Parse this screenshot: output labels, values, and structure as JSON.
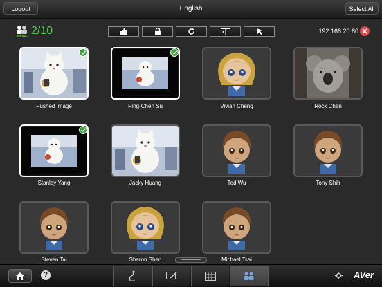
{
  "topbar": {
    "logout_label": "Logout",
    "title": "English",
    "select_all_label": "Select All"
  },
  "status": {
    "online_label": "ONLINE",
    "count": "2/10",
    "ip": "192.168.20.80"
  },
  "toolbar": {
    "items": [
      "thumbs-up-icon",
      "lock-icon",
      "refresh-icon",
      "split-screen-icon",
      "pointer-icon"
    ]
  },
  "students": [
    {
      "name": "Pushed Image",
      "selected": true,
      "type": "cat"
    },
    {
      "name": "Ping-Chen Su",
      "selected": true,
      "type": "screen"
    },
    {
      "name": "Vivian Cheng",
      "selected": false,
      "type": "girl"
    },
    {
      "name": "Rock Chen",
      "selected": false,
      "type": "koala"
    },
    {
      "name": "Stanley Yang",
      "selected": true,
      "type": "screen"
    },
    {
      "name": "Jacky Huang",
      "selected": false,
      "type": "cat"
    },
    {
      "name": "Ted Wu",
      "selected": false,
      "type": "boy"
    },
    {
      "name": "Tony Shih",
      "selected": false,
      "type": "boy"
    },
    {
      "name": "Steven Tai",
      "selected": false,
      "type": "boy"
    },
    {
      "name": "Sharon Shen",
      "selected": false,
      "type": "girl"
    },
    {
      "name": "Michael Tsai",
      "selected": false,
      "type": "boy"
    }
  ],
  "bottombar": {
    "logo": "AVer"
  },
  "colors": {
    "online": "#49d045",
    "check": "#3aa63a",
    "disconnect": "#e04a4a"
  }
}
